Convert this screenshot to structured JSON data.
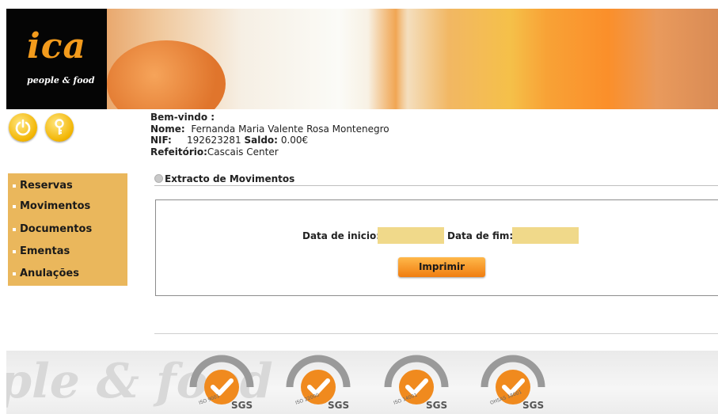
{
  "logo": {
    "word": "ica",
    "tagline": "people & food"
  },
  "welcome": {
    "greeting": "Bem-vindo :",
    "name_label": "Nome:",
    "name_value": "Fernanda Maria Valente Rosa Montenegro",
    "nif_label": "NIF:",
    "nif_value": "192623281",
    "saldo_label": "Saldo:",
    "saldo_value": "0.00€",
    "refeitorio_label": "Refeitório:",
    "refeitorio_value": "Cascais Center"
  },
  "menu": {
    "items": [
      {
        "label": "Reservas"
      },
      {
        "label": "Movimentos"
      },
      {
        "label": "Documentos"
      },
      {
        "label": "Ementas"
      },
      {
        "label": "Anulações"
      }
    ]
  },
  "content": {
    "title": "Extracto de Movimentos",
    "start_label": "Data de inicio:",
    "start_value": "",
    "end_label": "Data de fim:",
    "end_value": "",
    "print_button": "Imprimir"
  },
  "footer": {
    "watermark": "ple & food",
    "certs": [
      {
        "label": "SGS",
        "standard": "ISO 9001"
      },
      {
        "label": "SGS",
        "standard": "ISO 22000"
      },
      {
        "label": "SGS",
        "standard": "ISO 14001"
      },
      {
        "label": "SGS",
        "standard": "OHSAS 18001"
      }
    ]
  },
  "colors": {
    "menu_bg": "#eab75c",
    "field_bg": "#f0d98a",
    "button": "#f07d10",
    "logo_accent": "#f39b1c"
  }
}
